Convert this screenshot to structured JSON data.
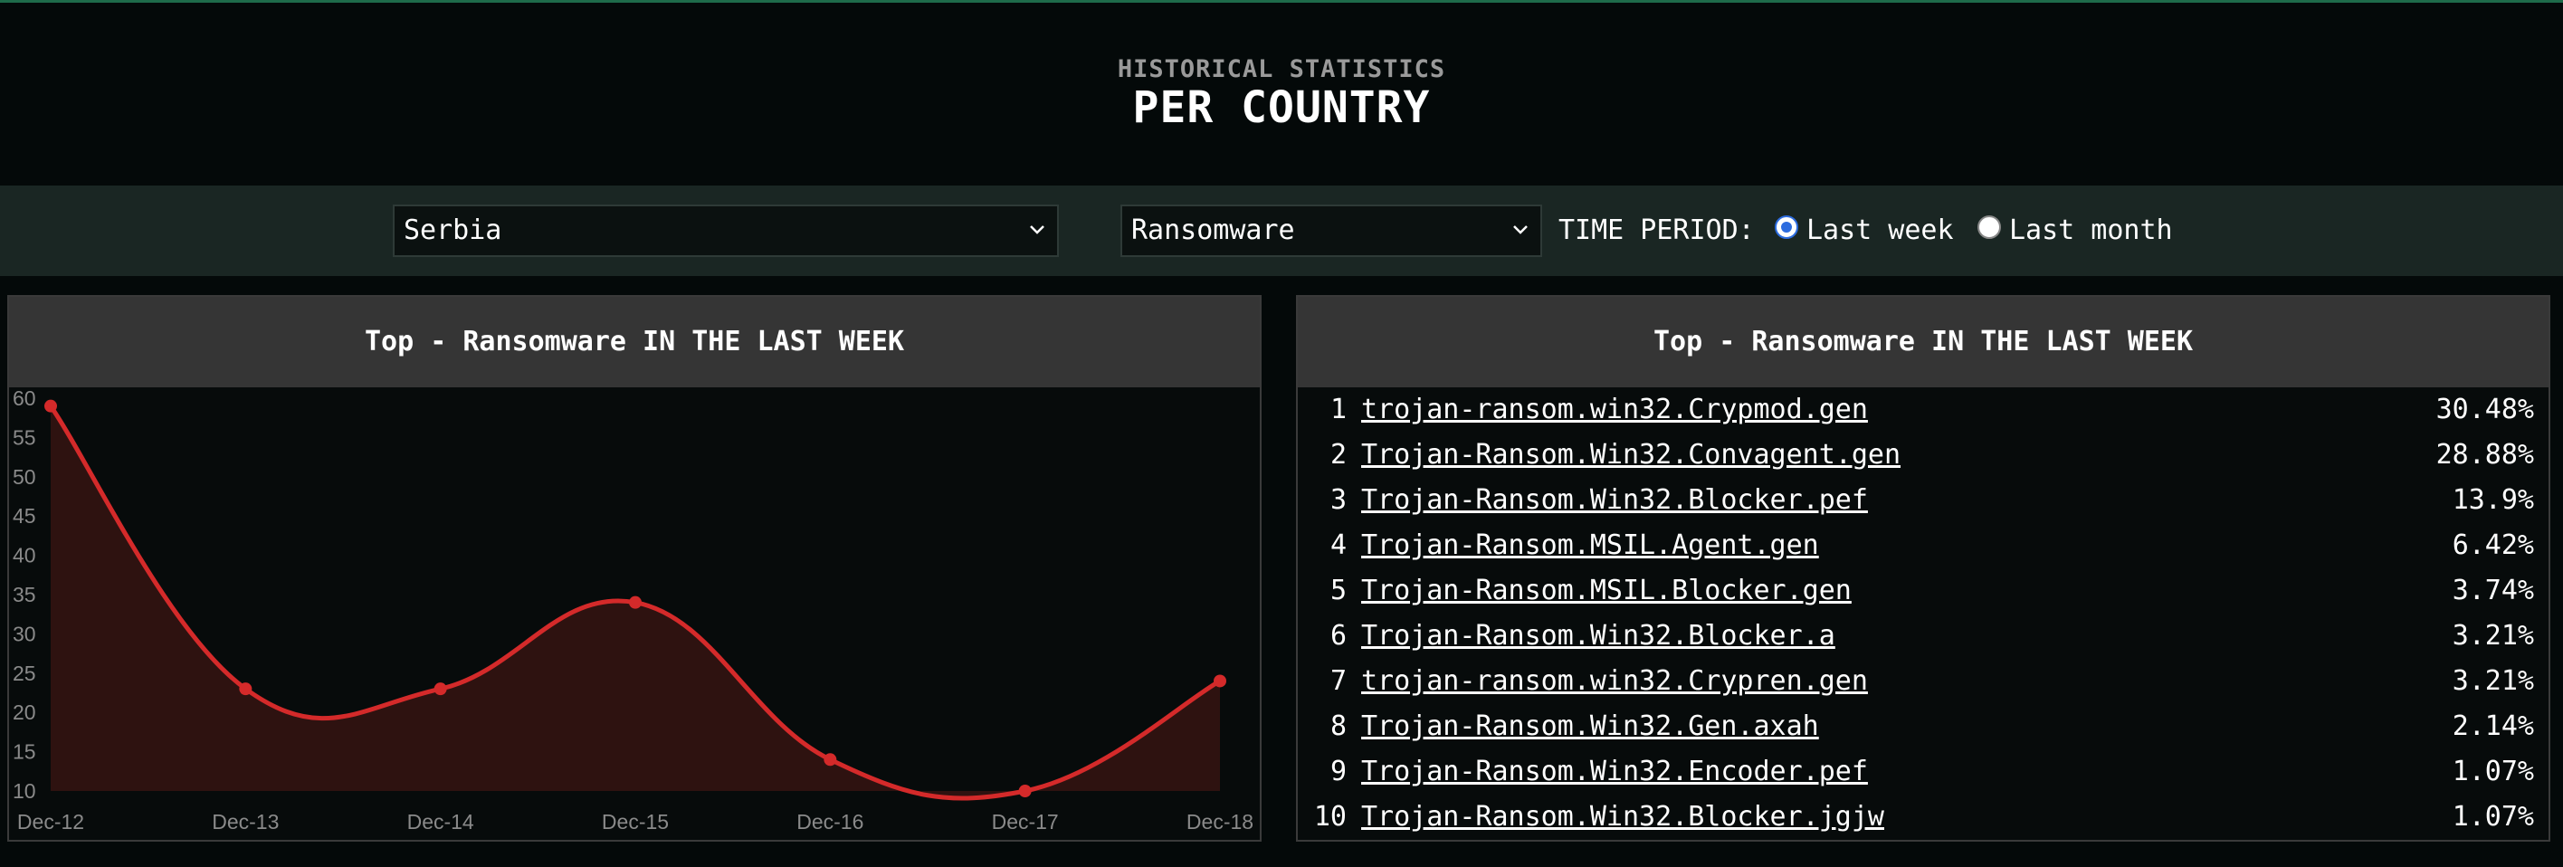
{
  "header": {
    "subtitle": "HISTORICAL STATISTICS",
    "title": "PER COUNTRY"
  },
  "controls": {
    "country_select": "Serbia",
    "category_select": "Ransomware",
    "time_period_label": "TIME PERIOD:",
    "radio_week_label": "Last week",
    "radio_month_label": "Last month",
    "selected_period": "Last week"
  },
  "chart_panel": {
    "title": "Top - Ransomware IN THE LAST WEEK"
  },
  "list_panel": {
    "title": "Top - Ransomware IN THE LAST WEEK",
    "items": [
      {
        "rank": "1",
        "name": "trojan-ransom.win32.Crypmod.gen",
        "pct": "30.48%"
      },
      {
        "rank": "2",
        "name": "Trojan-Ransom.Win32.Convagent.gen",
        "pct": "28.88%"
      },
      {
        "rank": "3",
        "name": "Trojan-Ransom.Win32.Blocker.pef",
        "pct": "13.9%"
      },
      {
        "rank": "4",
        "name": "Trojan-Ransom.MSIL.Agent.gen",
        "pct": "6.42%"
      },
      {
        "rank": "5",
        "name": "Trojan-Ransom.MSIL.Blocker.gen",
        "pct": "3.74%"
      },
      {
        "rank": "6",
        "name": "Trojan-Ransom.Win32.Blocker.a",
        "pct": "3.21%"
      },
      {
        "rank": "7",
        "name": "trojan-ransom.win32.Crypren.gen",
        "pct": "3.21%"
      },
      {
        "rank": "8",
        "name": "Trojan-Ransom.Win32.Gen.axah",
        "pct": "2.14%"
      },
      {
        "rank": "9",
        "name": "Trojan-Ransom.Win32.Encoder.pef",
        "pct": "1.07%"
      },
      {
        "rank": "10",
        "name": "Trojan-Ransom.Win32.Blocker.jgjw",
        "pct": "1.07%"
      }
    ]
  },
  "colors": {
    "line": "#d42a2a",
    "fill": "#2e1210",
    "axis_text": "#8a8a8a",
    "radio_accent": "#2d6cdf"
  },
  "chart_data": {
    "type": "area",
    "title": "",
    "xlabel": "",
    "ylabel": "",
    "categories": [
      "Dec-12",
      "Dec-13",
      "Dec-14",
      "Dec-15",
      "Dec-16",
      "Dec-17",
      "Dec-18"
    ],
    "values": [
      59,
      23,
      23,
      34,
      14,
      10,
      24
    ],
    "ylim": [
      10,
      60
    ],
    "yticks": [
      10,
      15,
      20,
      25,
      30,
      35,
      40,
      45,
      50,
      55,
      60
    ],
    "grid": false,
    "smooth": true
  }
}
